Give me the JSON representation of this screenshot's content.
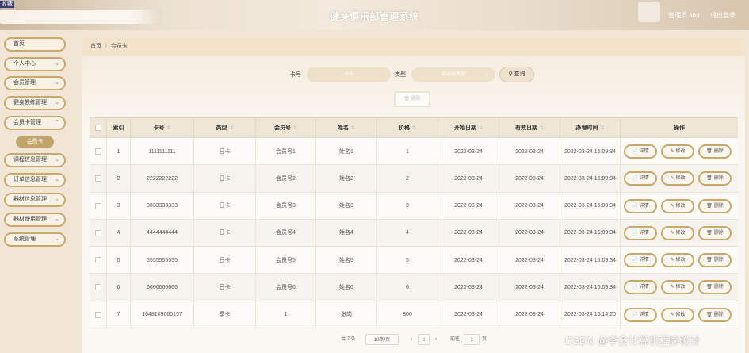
{
  "header": {
    "corner_label": "收藏",
    "title": "健身俱乐部管理系统",
    "admin_label": "管理员 abo",
    "logout_label": "退出登录"
  },
  "sidebar": {
    "items": [
      {
        "label": "首页",
        "chevron": false
      },
      {
        "label": "个人中心",
        "chevron": true
      },
      {
        "label": "会员管理",
        "chevron": true
      },
      {
        "label": "健身教练管理",
        "chevron": true
      },
      {
        "label": "会员卡管理",
        "chevron": true
      },
      {
        "label": "课程信息管理",
        "chevron": true
      },
      {
        "label": "订单信息管理",
        "chevron": true
      },
      {
        "label": "器材信息管理",
        "chevron": true
      },
      {
        "label": "器材使用管理",
        "chevron": true
      },
      {
        "label": "系统管理",
        "chevron": true
      }
    ],
    "active_sub_item": "会员卡"
  },
  "breadcrumb": {
    "home": "首页",
    "separator": "/",
    "current": "会员卡"
  },
  "search": {
    "card_no_label": "卡号",
    "card_no_placeholder": "卡号",
    "type_label": "类型",
    "type_placeholder": "请选择类型",
    "search_button": "查询",
    "bulk_delete_button": "删除"
  },
  "table": {
    "headers": [
      "索引",
      "卡号",
      "类型",
      "会员号",
      "姓名",
      "价格",
      "开始日期",
      "有效日期",
      "办理时间",
      "操作"
    ],
    "sortable": [
      true,
      true,
      true,
      true,
      true,
      true,
      true,
      true,
      true,
      false
    ],
    "rows": [
      {
        "index": "1",
        "card_no": "1111111111",
        "type": "日卡",
        "member_no": "会员号1",
        "name": "姓名1",
        "price": "1",
        "start": "2022-03-24",
        "valid": "2022-03-24",
        "time": "2022-03-24 16:09:34"
      },
      {
        "index": "2",
        "card_no": "2222222222",
        "type": "日卡",
        "member_no": "会员号2",
        "name": "姓名2",
        "price": "2",
        "start": "2022-03-24",
        "valid": "2022-03-24",
        "time": "2022-03-24 16:09:34"
      },
      {
        "index": "3",
        "card_no": "3333333333",
        "type": "日卡",
        "member_no": "会员号3",
        "name": "姓名3",
        "price": "3",
        "start": "2022-03-24",
        "valid": "2022-03-24",
        "time": "2022-03-24 16:09:34"
      },
      {
        "index": "4",
        "card_no": "4444444444",
        "type": "日卡",
        "member_no": "会员号4",
        "name": "姓名4",
        "price": "4",
        "start": "2022-03-24",
        "valid": "2022-03-24",
        "time": "2022-03-24 16:09:34"
      },
      {
        "index": "5",
        "card_no": "5555555555",
        "type": "日卡",
        "member_no": "会员号5",
        "name": "姓名5",
        "price": "5",
        "start": "2022-03-24",
        "valid": "2022-03-24",
        "time": "2022-03-24 16:09:34"
      },
      {
        "index": "6",
        "card_no": "6666666666",
        "type": "日卡",
        "member_no": "会员号6",
        "name": "姓名6",
        "price": "6",
        "start": "2022-03-24",
        "valid": "2022-03-24",
        "time": "2022-03-24 16:09:34"
      },
      {
        "index": "7",
        "card_no": "1648109660157",
        "type": "季卡",
        "member_no": "1",
        "name": "张岗",
        "price": "800",
        "start": "2022-03-24",
        "valid": "2022-09-24",
        "time": "2022-03-24 16:14:20"
      }
    ],
    "actions": {
      "detail": "详情",
      "edit": "修改",
      "delete": "删除"
    }
  },
  "pagination": {
    "total_text": "共 7 条",
    "page_size": "10条/页",
    "current_page": "1",
    "goto_label": "前往",
    "goto_value": "1",
    "page_suffix": "页"
  },
  "watermark": "CSDN @李会计算机程序设计"
}
